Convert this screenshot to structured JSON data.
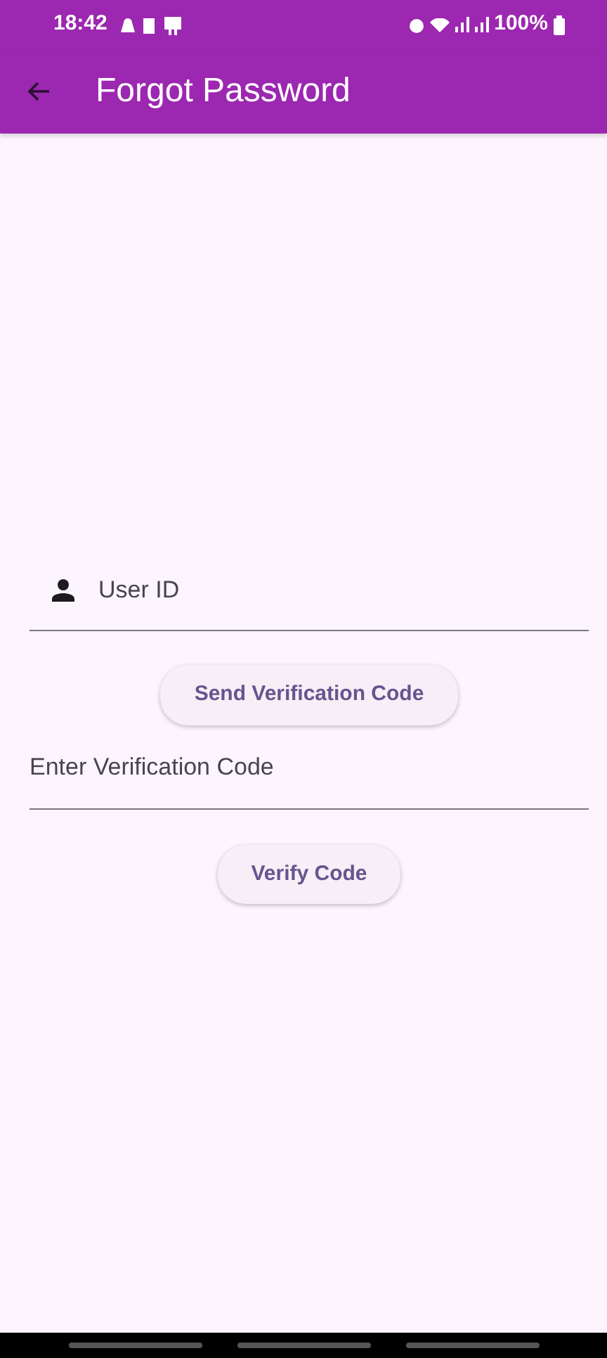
{
  "status_bar": {
    "time": "18:42",
    "battery": "100%"
  },
  "app_bar": {
    "title": "Forgot Password"
  },
  "user_id_field": {
    "placeholder": "User ID"
  },
  "send_button": {
    "label": "Send Verification Code"
  },
  "code_field": {
    "placeholder": "Enter Verification Code"
  },
  "verify_button": {
    "label": "Verify Code"
  }
}
